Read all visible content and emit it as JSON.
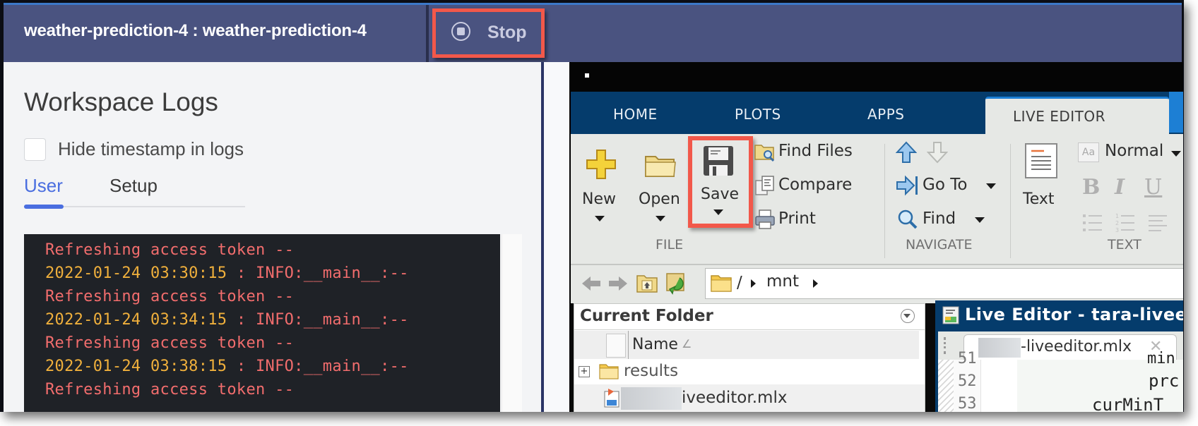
{
  "header": {
    "title": "weather-prediction-4 : weather-prediction-4",
    "stop_label": "Stop",
    "highlight_color": "#f2584a",
    "bg_color": "#4a5380"
  },
  "logs_panel": {
    "title": "Workspace Logs",
    "hide_timestamp_label": "Hide timestamp in logs",
    "hide_timestamp_checked": false,
    "tabs": [
      {
        "label": "User",
        "active": true
      },
      {
        "label": "Setup",
        "active": false
      }
    ],
    "lines": [
      {
        "timestamp": "",
        "text": "Refreshing access token --"
      },
      {
        "timestamp": "2022-01-24 03:30:15",
        "text": " : INFO:__main__:--"
      },
      {
        "timestamp": "",
        "text": "Refreshing access token --"
      },
      {
        "timestamp": "2022-01-24 03:34:15",
        "text": " : INFO:__main__:--"
      },
      {
        "timestamp": "",
        "text": "Refreshing access token --"
      },
      {
        "timestamp": "2022-01-24 03:38:15",
        "text": " : INFO:__main__:--"
      },
      {
        "timestamp": "",
        "text": "Refreshing access token --"
      }
    ]
  },
  "matlab": {
    "ribbon_tabs": [
      {
        "label": "HOME",
        "active": false
      },
      {
        "label": "PLOTS",
        "active": false
      },
      {
        "label": "APPS",
        "active": false
      },
      {
        "label": "LIVE EDITOR",
        "active": true
      }
    ],
    "file_group": {
      "label": "FILE",
      "new": "New",
      "open": "Open",
      "save": "Save",
      "find_files": "Find Files",
      "compare": "Compare",
      "print": "Print"
    },
    "navigate_group": {
      "label": "NAVIGATE",
      "go_to": "Go To",
      "find": "Find"
    },
    "text_group": {
      "label": "TEXT",
      "text": "Text",
      "style": "Normal",
      "bold": "B",
      "italic": "I",
      "underline": "U"
    },
    "address": {
      "root": "/",
      "segment": "mnt"
    },
    "current_folder": {
      "title": "Current Folder",
      "column_name": "Name",
      "sort_indicator": "∠",
      "items": [
        {
          "name": "results",
          "type": "folder",
          "expandable": true
        },
        {
          "name": "iveeditor.mlx",
          "type": "mlx",
          "partially_redacted": true
        }
      ]
    },
    "live_editor": {
      "title": "Live Editor - tara-livee",
      "tab_label": "-liveeditor.mlx",
      "line_numbers": [
        "51",
        "52",
        "53"
      ],
      "code_fragments": [
        "min",
        "prc",
        "curMinT"
      ]
    }
  }
}
